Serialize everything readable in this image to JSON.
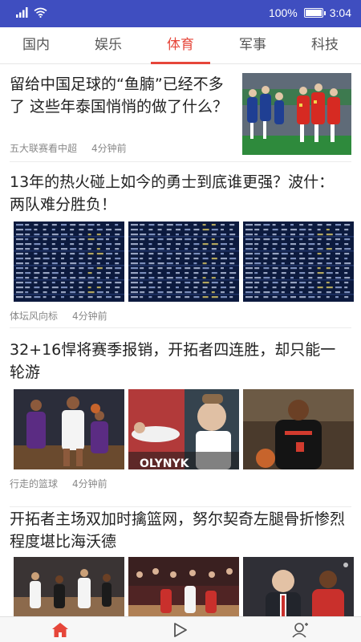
{
  "status_bar": {
    "battery": "100%",
    "time": "3:04",
    "battery_level": 1.0,
    "icons": [
      "signal-icon",
      "wifi-icon",
      "battery-icon"
    ]
  },
  "tabs": [
    {
      "label": "国内",
      "active": false
    },
    {
      "label": "娱乐",
      "active": false
    },
    {
      "label": "体育",
      "active": true
    },
    {
      "label": "军事",
      "active": false
    },
    {
      "label": "科技",
      "active": false
    }
  ],
  "feed": [
    {
      "title": "留给中国足球的“鱼腩”已经不多了 这些年泰国悄悄的做了什么？",
      "source": "五大联赛看中超",
      "time": "4分钟前",
      "layout": "right-thumb"
    },
    {
      "title": "13年的热火碰上如今的勇士到底谁更强？波什：两队难分胜负！",
      "source": "体坛风向标",
      "time": "4分钟前",
      "layout": "three-pics"
    },
    {
      "title": "32+16悍将赛季报销，开拓者四连胜，却只能一轮游",
      "source": "行走的篮球",
      "time": "4分钟前",
      "layout": "three-pics",
      "pic_caption": "OLYNYK"
    },
    {
      "title": "开拓者主场双加时擒篮网，努尔契奇左腿骨折惨烈程度堪比海沃德",
      "layout": "three-pics"
    }
  ],
  "bottom_nav": [
    {
      "icon": "home-icon",
      "active": true
    },
    {
      "icon": "play-icon",
      "active": false
    },
    {
      "icon": "profile-icon",
      "active": false
    }
  ],
  "colors": {
    "status_bar": "#3f4ec0",
    "accent": "#e6463a",
    "thai_jersey": "#1f3f93",
    "china_jersey": "#d62a22",
    "pitch": "#2e8a3c",
    "stats_table": "#0c1a3e"
  }
}
